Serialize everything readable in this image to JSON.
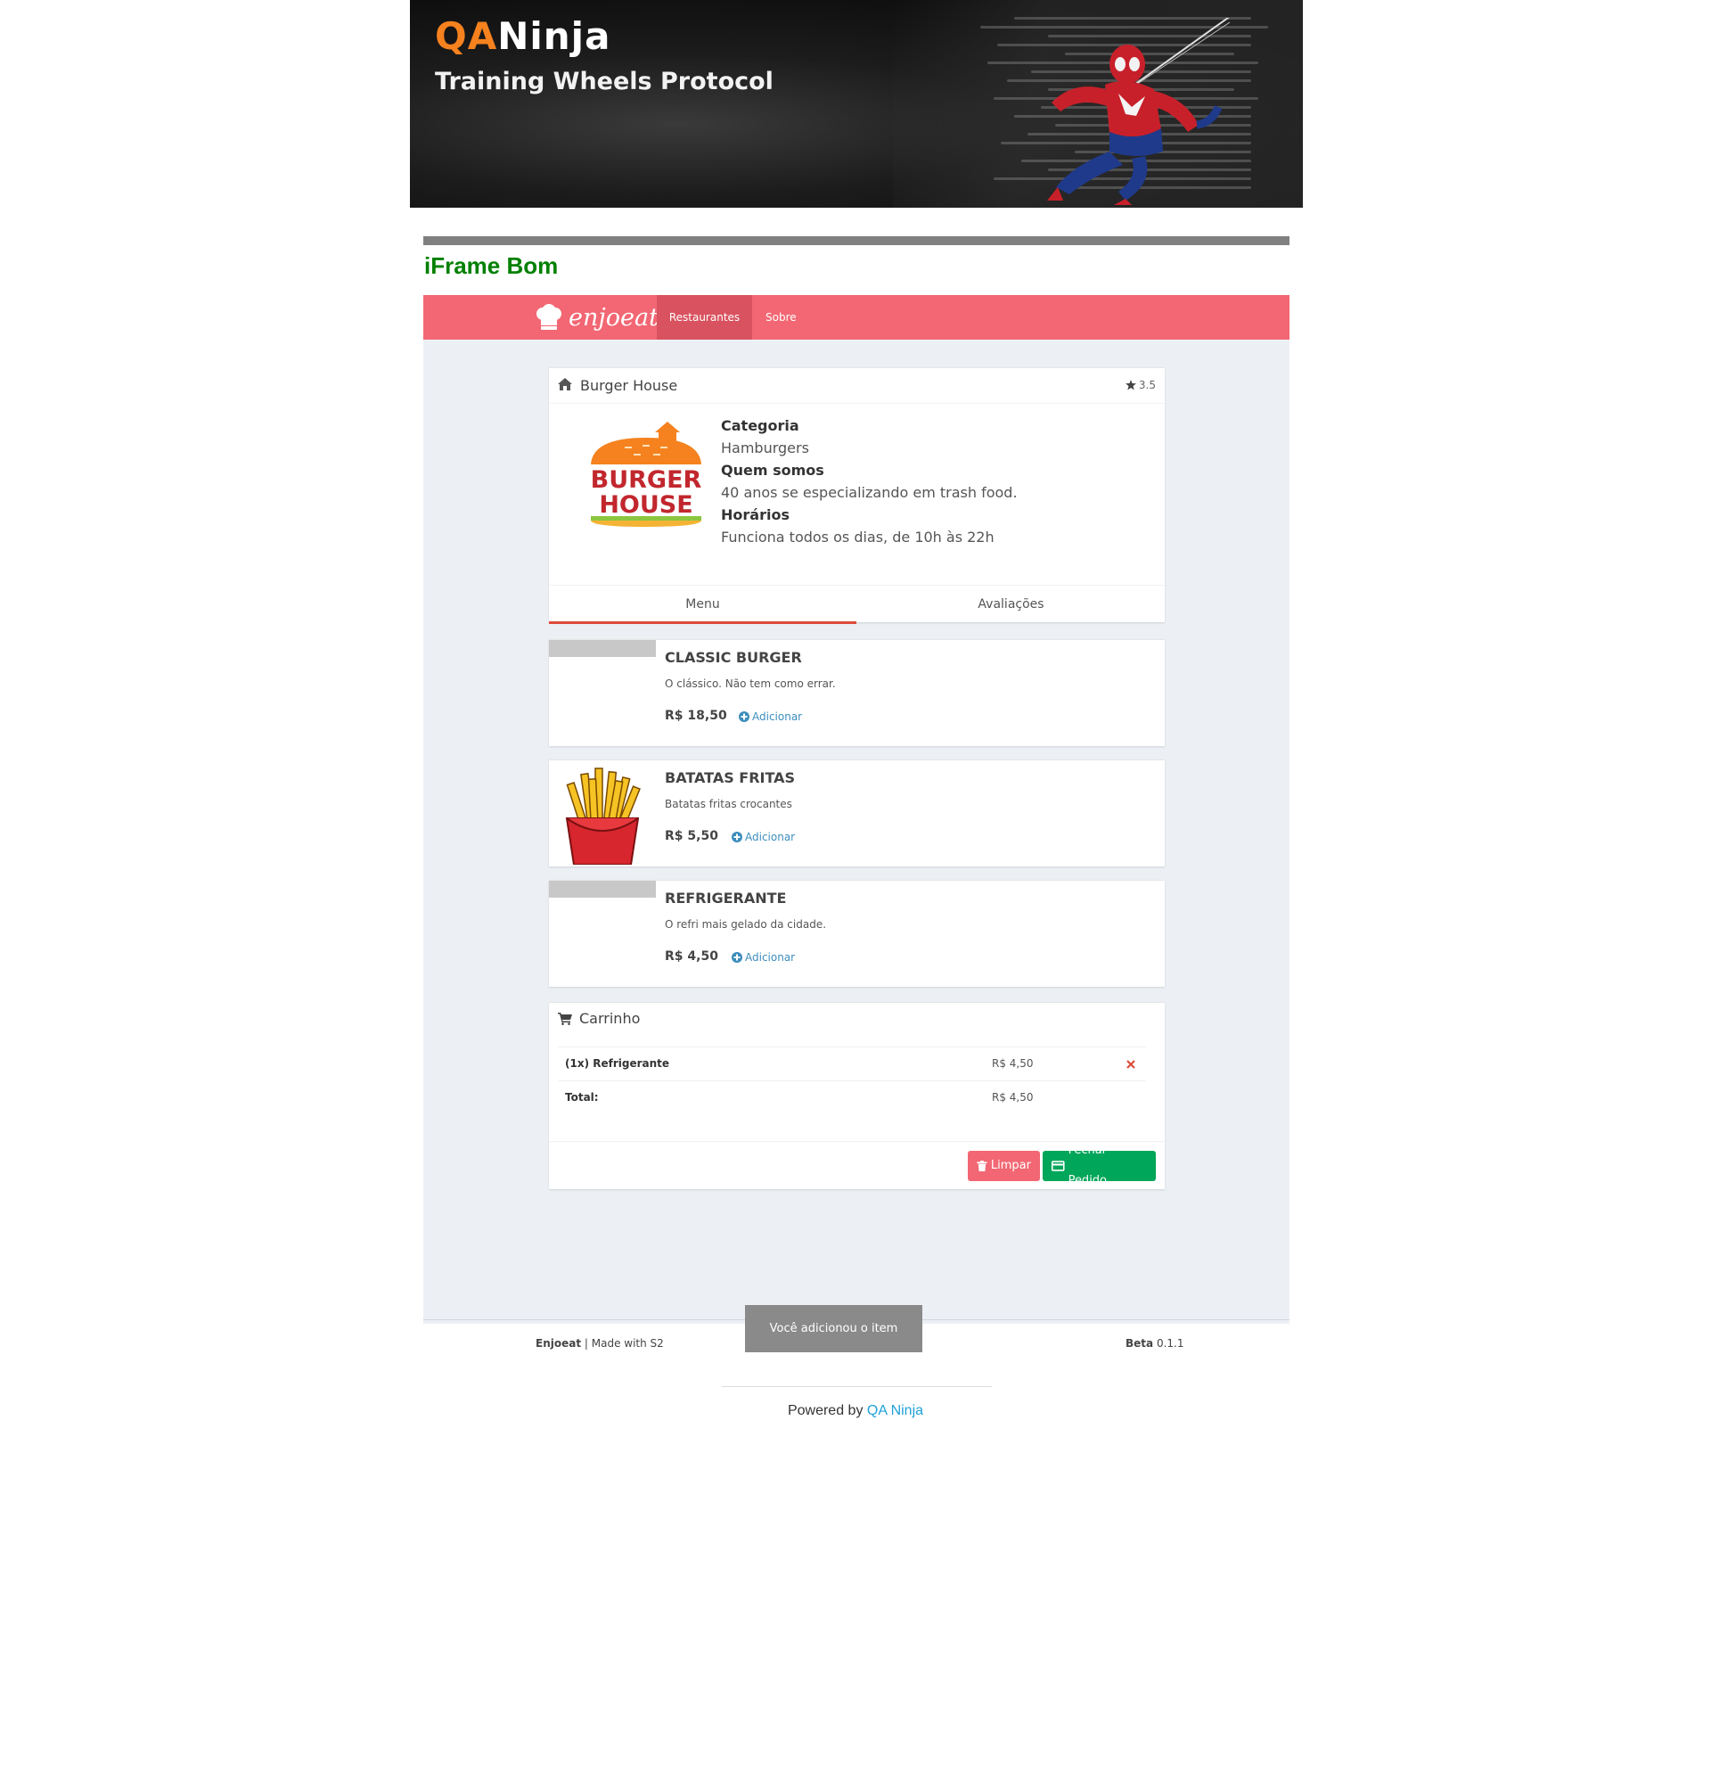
{
  "banner": {
    "logo_left": "QA",
    "logo_right": "Ninja",
    "subtitle": "Training Wheels Protocol",
    "accent": "#f5821f"
  },
  "heading": {
    "title": "iFrame Bom",
    "color": "#008000"
  },
  "app": {
    "brand": "enjoeat",
    "brand_color": "#f26773",
    "nav": {
      "restaurantes": "Restaurantes",
      "sobre": "Sobre"
    },
    "restaurant": {
      "name": "Burger House",
      "rating": "3.5",
      "logo_line1": "BURGER",
      "logo_line2": "HOUSE",
      "category_label": "Categoria",
      "category": "Hamburgers",
      "about_label": "Quem somos",
      "about": "40 anos se especializando em trash food.",
      "hours_label": "Horários",
      "hours": "Funciona todos os dias, de 10h às 22h"
    },
    "tabs": {
      "menu": "Menu",
      "reviews": "Avaliações"
    },
    "menu_items": [
      {
        "title": "CLASSIC BURGER",
        "desc": "O clássico. Não tem como errar.",
        "price": "R$ 18,50",
        "add": "Adicionar"
      },
      {
        "title": "BATATAS FRITAS",
        "desc": "Batatas fritas crocantes",
        "price": "R$ 5,50",
        "add": "Adicionar"
      },
      {
        "title": "REFRIGERANTE",
        "desc": "O refri mais gelado da cidade.",
        "price": "R$ 4,50",
        "add": "Adicionar"
      }
    ],
    "cart": {
      "title": "Carrinho",
      "item_name": "(1x) Refrigerante",
      "item_price": "R$ 4,50",
      "total_label": "Total:",
      "total_value": "R$ 4,50",
      "clear_label": "Limpar",
      "checkout_label": "Fechar Pedido"
    },
    "toast": "Você adicionou o item Refrigerante",
    "footer": {
      "brand": "Enjoeat",
      "made_with": " | Made with S2",
      "beta_label": "Beta",
      "version": " 0.1.1"
    }
  },
  "powered": {
    "prefix": "Powered by ",
    "link": "QA Ninja"
  }
}
